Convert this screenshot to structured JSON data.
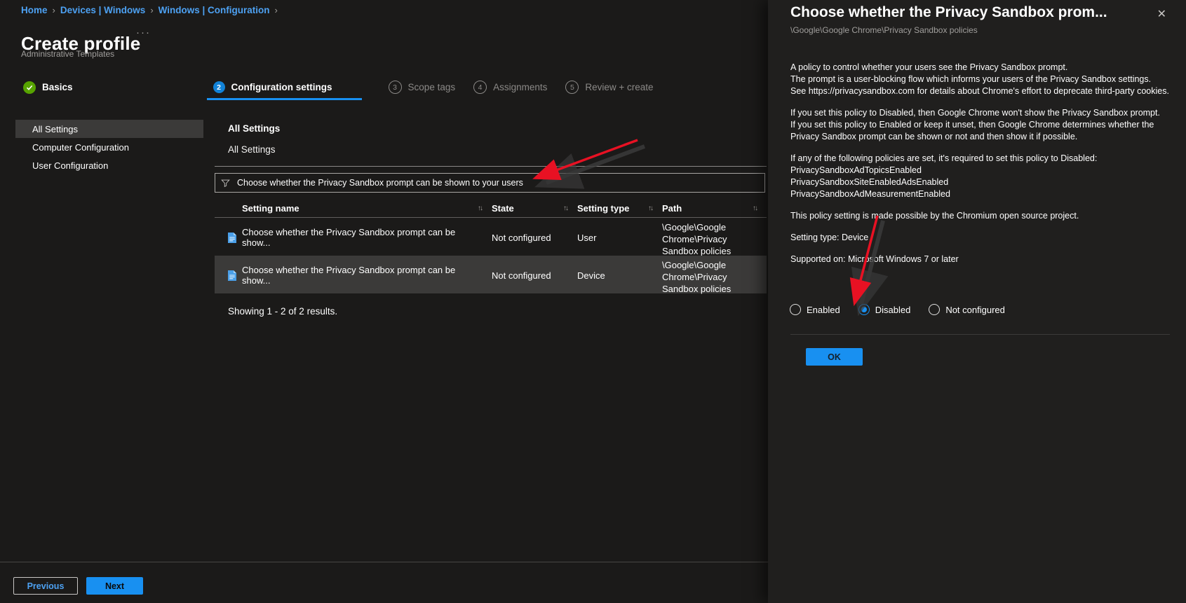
{
  "colors": {
    "accent_blue": "#1890f1",
    "link_blue": "#4da1f2",
    "success_green": "#57a300",
    "annotation_red": "#e81123",
    "selected_row_bg": "#3b3a39",
    "page_bg": "#1b1a19",
    "pane_bg": "#201f1e"
  },
  "breadcrumb": {
    "items": [
      "Home",
      "Devices | Windows",
      "Windows | Configuration"
    ],
    "separator": "›"
  },
  "header": {
    "title": "Create profile",
    "ellipsis": "···",
    "subtitle": "Administrative Templates"
  },
  "steps": [
    {
      "label": "Basics",
      "state": "complete"
    },
    {
      "num": "2",
      "label": "Configuration settings",
      "state": "active"
    },
    {
      "num": "3",
      "label": "Scope tags",
      "state": "upcoming"
    },
    {
      "num": "4",
      "label": "Assignments",
      "state": "upcoming"
    },
    {
      "num": "5",
      "label": "Review + create",
      "state": "upcoming"
    }
  ],
  "sidebar": {
    "items": [
      {
        "label": "All Settings",
        "selected": true
      },
      {
        "label": "Computer Configuration",
        "selected": false
      },
      {
        "label": "User Configuration",
        "selected": false
      }
    ]
  },
  "main": {
    "section_title": "All Settings",
    "section_breadcrumb": "All Settings",
    "filter": {
      "value": "Choose whether the Privacy Sandbox prompt can be shown to your users"
    },
    "table": {
      "headers": [
        "Setting name",
        "State",
        "Setting type",
        "Path"
      ],
      "sort_icon": "↑↓",
      "rows": [
        {
          "name": "Choose whether the Privacy Sandbox prompt can be show...",
          "state": "Not configured",
          "type": "User",
          "path": "\\Google\\Google Chrome\\Privacy Sandbox policies",
          "selected": false
        },
        {
          "name": "Choose whether the Privacy Sandbox prompt can be show...",
          "state": "Not configured",
          "type": "Device",
          "path": "\\Google\\Google Chrome\\Privacy Sandbox policies",
          "selected": true
        }
      ]
    },
    "results_text": "Showing 1 - 2 of 2 results."
  },
  "footer": {
    "previous_label": "Previous",
    "next_label": "Next"
  },
  "panel": {
    "title": "Choose whether the Privacy Sandbox prom...",
    "close_icon": "✕",
    "subtitle": "\\Google\\Google Chrome\\Privacy Sandbox policies",
    "paragraphs": {
      "p1": "A policy to control whether your users see the Privacy Sandbox prompt.\nThe prompt is a user-blocking flow which informs your users of the Privacy Sandbox settings.\nSee https://privacysandbox.com for details about Chrome's effort to deprecate third-party cookies.",
      "p2": "If you set this policy to Disabled, then Google Chrome won't show the Privacy Sandbox prompt.\nIf you set this policy to Enabled or keep it unset, then Google Chrome determines whether the Privacy Sandbox prompt can be shown or not and then show it if possible.",
      "p3": "If any of the following policies are set, it's required to set this policy to Disabled:\nPrivacySandboxAdTopicsEnabled\nPrivacySandboxSiteEnabledAdsEnabled\nPrivacySandboxAdMeasurementEnabled",
      "p4": "This policy setting is made possible by the Chromium open source project.",
      "setting_type": "Setting type: Device",
      "supported_on": "Supported on: Microsoft Windows 7 or later"
    },
    "radios": [
      {
        "label": "Enabled",
        "selected": false
      },
      {
        "label": "Disabled",
        "selected": true
      },
      {
        "label": "Not configured",
        "selected": false
      }
    ],
    "ok_label": "OK"
  }
}
